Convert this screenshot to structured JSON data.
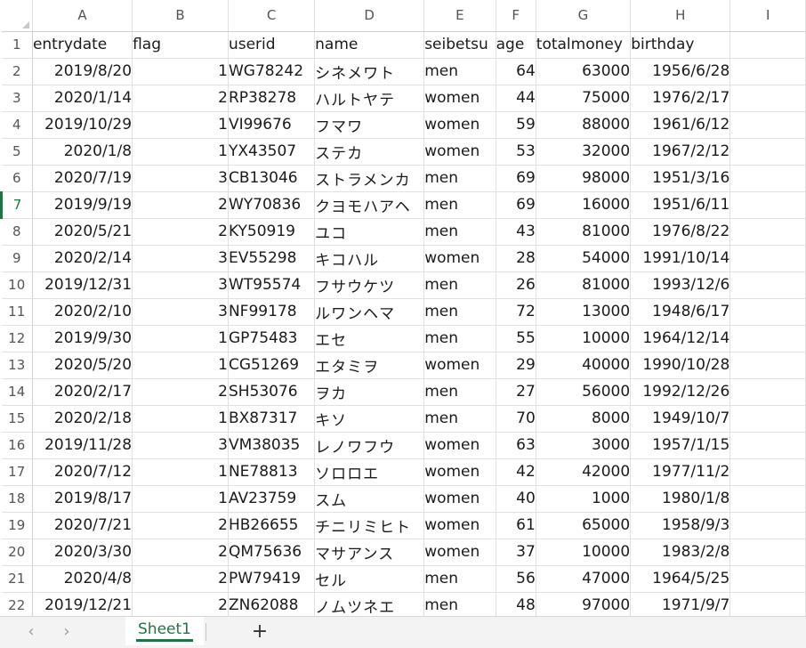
{
  "spreadsheet": {
    "column_headers": [
      "A",
      "B",
      "C",
      "D",
      "E",
      "F",
      "G",
      "H",
      "I"
    ],
    "field_types": [
      "num",
      "num",
      "txt",
      "jp",
      "txt",
      "num",
      "num",
      "num"
    ],
    "active_row": 7,
    "rows": [
      {
        "num": "1",
        "cells": [
          "entrydate",
          "flag",
          "userid",
          "name",
          "seibetsu",
          "age",
          "totalmoney",
          "birthday"
        ]
      },
      {
        "num": "2",
        "cells": [
          "2019/8/20",
          "1",
          "WG78242",
          "シネメワト",
          "men",
          "64",
          "63000",
          "1956/6/28"
        ]
      },
      {
        "num": "3",
        "cells": [
          "2020/1/14",
          "2",
          "RP38278",
          "ハルトヤテ",
          "women",
          "44",
          "75000",
          "1976/2/17"
        ]
      },
      {
        "num": "4",
        "cells": [
          "2019/10/29",
          "1",
          "VI99676",
          "フマワ",
          "women",
          "59",
          "88000",
          "1961/6/12"
        ]
      },
      {
        "num": "5",
        "cells": [
          "2020/1/8",
          "1",
          "YX43507",
          "ステカ",
          "women",
          "53",
          "32000",
          "1967/2/12"
        ]
      },
      {
        "num": "6",
        "cells": [
          "2020/7/19",
          "3",
          "CB13046",
          "ストラメンカ",
          "men",
          "69",
          "98000",
          "1951/3/16"
        ]
      },
      {
        "num": "7",
        "cells": [
          "2019/9/19",
          "2",
          "WY70836",
          "クヨモハアヘ",
          "men",
          "69",
          "16000",
          "1951/6/11"
        ]
      },
      {
        "num": "8",
        "cells": [
          "2020/5/21",
          "2",
          "KY50919",
          "ユコ",
          "men",
          "43",
          "81000",
          "1976/8/22"
        ]
      },
      {
        "num": "9",
        "cells": [
          "2020/2/14",
          "3",
          "EV55298",
          "キコハル",
          "women",
          "28",
          "54000",
          "1991/10/14"
        ]
      },
      {
        "num": "10",
        "cells": [
          "2019/12/31",
          "3",
          "WT95574",
          "フサウケツ",
          "men",
          "26",
          "81000",
          "1993/12/6"
        ]
      },
      {
        "num": "11",
        "cells": [
          "2020/2/10",
          "3",
          "NF99178",
          "ルワンヘマ",
          "men",
          "72",
          "13000",
          "1948/6/17"
        ]
      },
      {
        "num": "12",
        "cells": [
          "2019/9/30",
          "1",
          "GP75483",
          "エセ",
          "men",
          "55",
          "10000",
          "1964/12/14"
        ]
      },
      {
        "num": "13",
        "cells": [
          "2020/5/20",
          "1",
          "CG51269",
          "エタミヲ",
          "women",
          "29",
          "40000",
          "1990/10/28"
        ]
      },
      {
        "num": "14",
        "cells": [
          "2020/2/17",
          "2",
          "SH53076",
          "ヲカ",
          "men",
          "27",
          "56000",
          "1992/12/26"
        ]
      },
      {
        "num": "15",
        "cells": [
          "2020/2/18",
          "1",
          "BX87317",
          "キソ",
          "men",
          "70",
          "8000",
          "1949/10/7"
        ]
      },
      {
        "num": "16",
        "cells": [
          "2019/11/28",
          "3",
          "VM38035",
          "レノワフウ",
          "women",
          "63",
          "3000",
          "1957/1/15"
        ]
      },
      {
        "num": "17",
        "cells": [
          "2020/7/12",
          "1",
          "NE78813",
          "ソロロエ",
          "women",
          "42",
          "42000",
          "1977/11/2"
        ]
      },
      {
        "num": "18",
        "cells": [
          "2019/8/17",
          "1",
          "AV23759",
          "スム",
          "women",
          "40",
          "1000",
          "1980/1/8"
        ]
      },
      {
        "num": "19",
        "cells": [
          "2020/7/21",
          "2",
          "HB26655",
          "チニリミヒト",
          "women",
          "61",
          "65000",
          "1958/9/3"
        ]
      },
      {
        "num": "20",
        "cells": [
          "2020/3/30",
          "2",
          "QM75636",
          "マサアンス",
          "women",
          "37",
          "10000",
          "1983/2/8"
        ]
      },
      {
        "num": "21",
        "cells": [
          "2020/4/8",
          "2",
          "PW79419",
          "セル",
          "men",
          "56",
          "47000",
          "1964/5/25"
        ]
      },
      {
        "num": "22",
        "cells": [
          "2019/12/21",
          "2",
          "ZN62088",
          "ノムツネエ",
          "men",
          "48",
          "97000",
          "1971/9/7"
        ]
      }
    ]
  },
  "sheet_tabs": {
    "prev_icon": "chevron-left-icon",
    "next_icon": "chevron-right-icon",
    "active_sheet": "Sheet1",
    "add_icon": "plus-icon"
  },
  "colors": {
    "accent": "#217346",
    "gridline": "#e1e1e1",
    "header_text": "#555555"
  }
}
